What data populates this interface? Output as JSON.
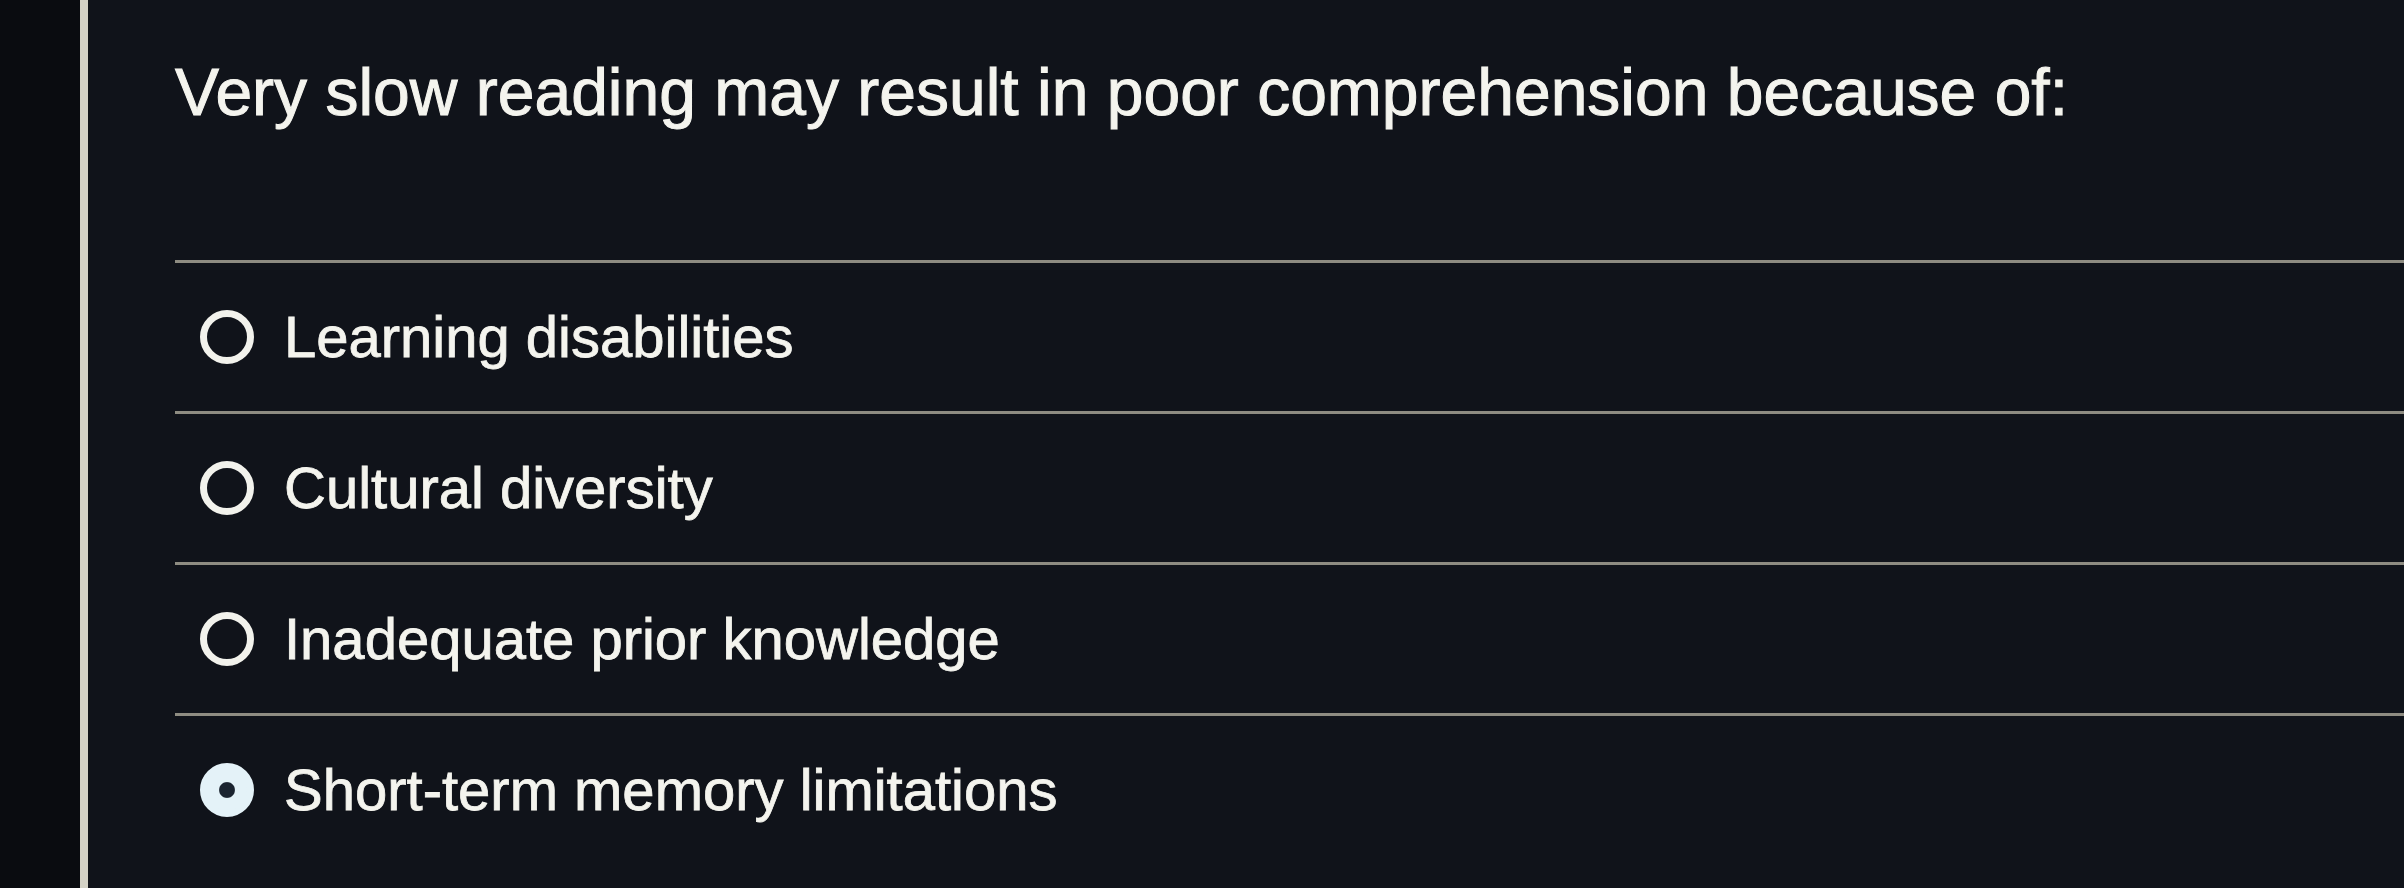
{
  "question": {
    "text": "Very slow reading may result in poor comprehension because of:"
  },
  "options": [
    {
      "label": "Learning disabilities",
      "selected": false
    },
    {
      "label": "Cultural diversity",
      "selected": false
    },
    {
      "label": "Inadequate prior knowledge",
      "selected": false
    },
    {
      "label": "Short-term memory limitations",
      "selected": true
    }
  ]
}
